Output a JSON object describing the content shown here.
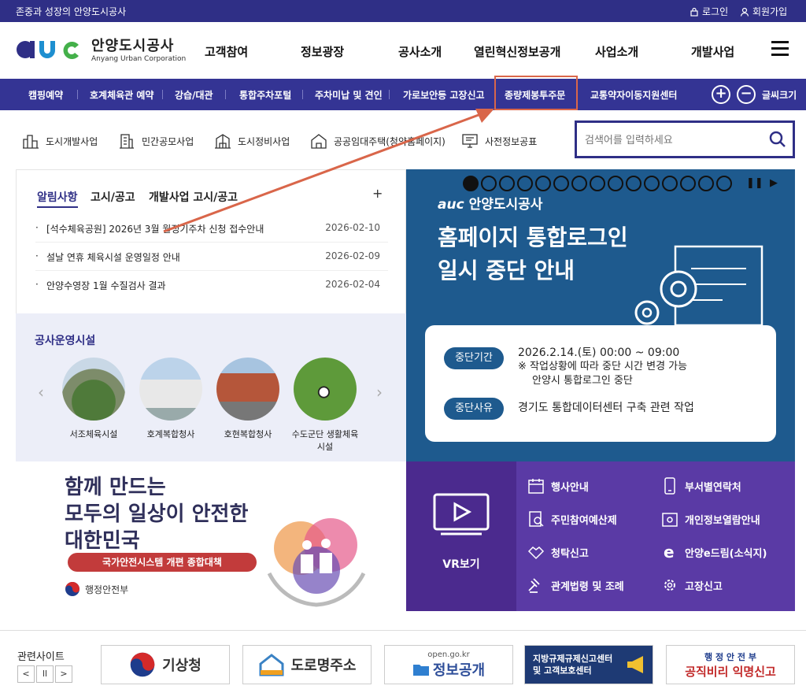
{
  "topbar": {
    "slogan": "존중과 성장의 안양도시공사",
    "login": "로그인",
    "signup": "회원가입"
  },
  "header": {
    "logo_ko": "안양도시공사",
    "logo_en": "Anyang Urban Corporation",
    "nav": [
      "고객참여",
      "정보광장",
      "공사소개",
      "열린혁신정보공개",
      "사업소개",
      "개발사업"
    ]
  },
  "quickbar": {
    "items": [
      "캠핑예약",
      "호계체육관 예약",
      "강습/대관",
      "통합주차포털",
      "주차미납 및 견인",
      "가로보안등 고장신고",
      "종량제봉투주문",
      "교통약자이동지원센터"
    ],
    "font_size_label": "글씨크기",
    "zoom_in": "+",
    "zoom_out": "−"
  },
  "business": [
    "도시개발사업",
    "민간공모사업",
    "도시정비사업",
    "공공임대주택(청약홈페이지)",
    "사전정보공표"
  ],
  "search": {
    "placeholder": "검색어를 입력하세요"
  },
  "notice": {
    "tabs": [
      "알림사항",
      "고시/공고",
      "개발사업 고시/공고"
    ],
    "plus": "+",
    "items": [
      {
        "title": "[석수체육공원] 2026년 3월 월정기주차 신청 접수안내",
        "date": "2026-02-10"
      },
      {
        "title": "설날 연휴 체육시설 운영일정 안내",
        "date": "2026-02-09"
      },
      {
        "title": "안양수영장 1월 수질검사 결과",
        "date": "2026-02-04"
      }
    ]
  },
  "facilities": {
    "title": "공사운영시설",
    "items": [
      "서조체육시설",
      "호계복합청사",
      "호현복합청사",
      "수도군단 생활체육시설"
    ],
    "prev": "‹",
    "next": "›"
  },
  "banner": {
    "logo": "안양도시공사",
    "headline_1": "홈페이지 통합로그인",
    "headline_2": "일시 중단 안내",
    "label_period": "중단기간",
    "period_1": "2026.2.14.(토) 00:00 ~ 09:00",
    "period_2": "※ 작업상황에 따라 중단 시간 변경 가능",
    "period_3": "안양시 통합로그인 중단",
    "label_reason": "중단사유",
    "reason": "경기도 통합데이터센터 구축 관련 작업",
    "dot_count": 15,
    "active_dot": 1,
    "pause": "❚❚",
    "play": "▶"
  },
  "safety": {
    "line1": "함께 만드는",
    "line2": "모두의 일상이 안전한",
    "line3": "대한민국",
    "subtitle": "국가안전시스템 개편 종합대책",
    "ministry": "행정안전부"
  },
  "vr": {
    "label": "VR보기"
  },
  "links": [
    "행사안내",
    "부서별연락처",
    "주민참여예산제",
    "개인정보열람안내",
    "청탁신고",
    "안양e드림(소식지)",
    "관계법령 및 조례",
    "고장신고"
  ],
  "related": {
    "title": "관련사이트",
    "prev": "<",
    "pause": "ll",
    "next": ">",
    "sites": [
      "기상청",
      "도로명주소",
      "정보공개",
      "지방규제규제신고센터 및 고객보호센터",
      "공직비리 익명신고"
    ],
    "site_extra": {
      "open": "open.go.kr",
      "ministry": "행 정 안 전 부"
    }
  },
  "colors": {
    "primary": "#2f2f86",
    "quickbar": "#343494",
    "banner": "#1e5a8e",
    "vr": "#4b2a8e",
    "links": "#5a3aa5",
    "highlight": "#d9664a"
  }
}
